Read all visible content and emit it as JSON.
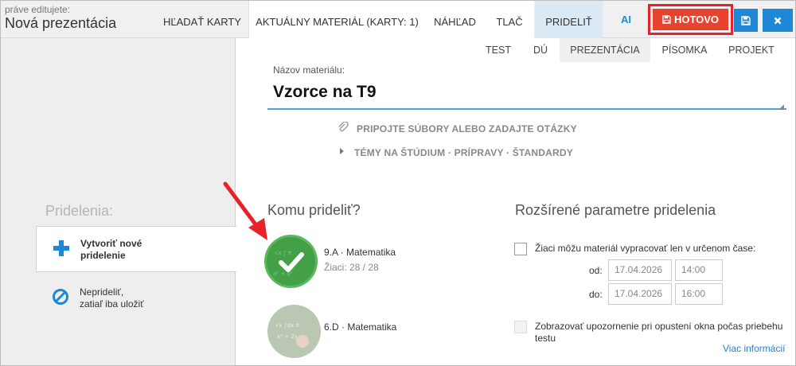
{
  "header": {
    "editing_label": "práve editujete:",
    "doc_title": "Nová prezentácia",
    "tabs": [
      {
        "label": "HĽADAŤ KARTY"
      },
      {
        "label": "AKTUÁLNY MATERIÁL (KARTY: 1)"
      },
      {
        "label": "NÁHĽAD"
      },
      {
        "label": "TLAČ"
      },
      {
        "label": "PRIDELIŤ"
      }
    ],
    "ai_label": "AI",
    "done_label": "HOTOVO",
    "save_icon": "floppy-icon",
    "close_icon": "close-icon"
  },
  "material_tabs": [
    {
      "label": "TEST"
    },
    {
      "label": "DÚ"
    },
    {
      "label": "PREZENTÁCIA"
    },
    {
      "label": "PÍSOMKA"
    },
    {
      "label": "PROJEKT"
    }
  ],
  "material": {
    "name_label": "Názov materiálu:",
    "name_value": "Vzorce na T9",
    "attach_label": "PRIPOJTE SÚBORY ALEBO ZADAJTE OTÁZKY",
    "topics_label": "TÉMY NA ŠTÚDIUM · PRÍPRAVY · ŠTANDARDY"
  },
  "sidebar": {
    "title": "Pridelenia:",
    "items": [
      {
        "label_line1": "Vytvoriť nové",
        "label_line2": "pridelenie",
        "icon": "plus-icon"
      },
      {
        "label_line1": "Neprideliť,",
        "label_line2": "zatiaľ iba uložiť",
        "icon": "ban-icon"
      }
    ]
  },
  "assign": {
    "title": "Komu prideliť?",
    "classes": [
      {
        "name": "9.A · Matematika",
        "sub": "Žiaci: 28 / 28",
        "selected": true
      },
      {
        "name": "6.D · Matematika",
        "sub": "",
        "selected": false
      }
    ]
  },
  "advanced": {
    "title": "Rozšírené parametre pridelenia",
    "time_limit_label": "Žiaci môžu materiál vypracovať len v určenom čase:",
    "from_label": "od:",
    "to_label": "do:",
    "from_date": "17.04.2026",
    "from_time": "14:00",
    "to_date": "17.04.2026",
    "to_time": "16:00",
    "warning_line1": "Zobrazovať upozornenie pri opustení okna počas priebehu",
    "warning_line2": "testu",
    "more_info": "Viac informácií"
  },
  "colors": {
    "accent": "#1e88d6",
    "done": "#e9432d",
    "highlight": "#e8222b",
    "selected_class": "#43a047"
  }
}
